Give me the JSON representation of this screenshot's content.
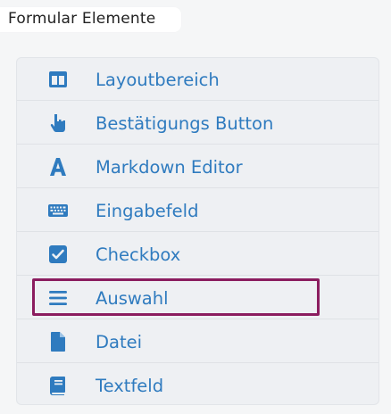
{
  "section": {
    "title": "Formular Elemente"
  },
  "items": [
    {
      "label": "Layoutbereich",
      "icon": "layout-columns-icon"
    },
    {
      "label": "Bestätigungs Button",
      "icon": "pointer-hand-icon"
    },
    {
      "label": "Markdown Editor",
      "icon": "letter-a-icon"
    },
    {
      "label": "Eingabefeld",
      "icon": "keyboard-icon"
    },
    {
      "label": "Checkbox",
      "icon": "checkbox-icon"
    },
    {
      "label": "Auswahl",
      "icon": "list-lines-icon",
      "selected": true
    },
    {
      "label": "Datei",
      "icon": "file-icon"
    },
    {
      "label": "Textfeld",
      "icon": "book-icon"
    }
  ],
  "colors": {
    "accent": "#2f7bbf",
    "selection": "#8b1d5f",
    "background": "#f5f6f7",
    "list_background": "#eef0f3"
  }
}
